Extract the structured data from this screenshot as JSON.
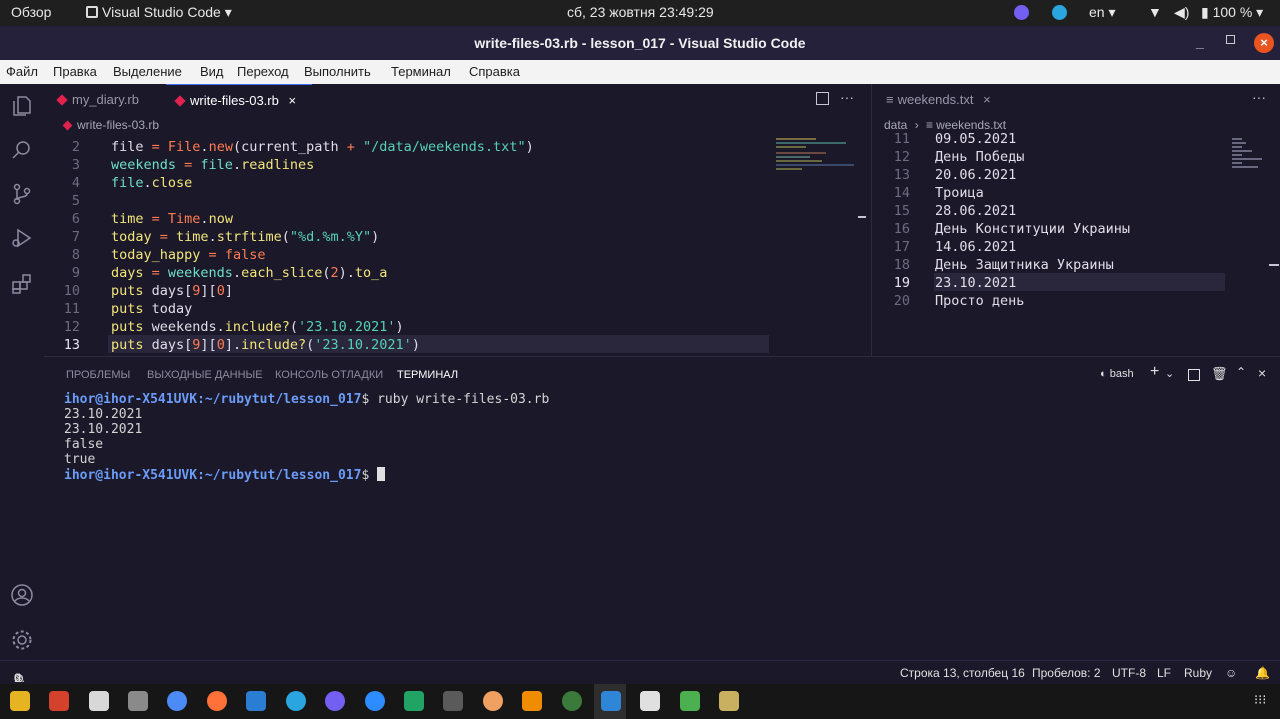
{
  "topbar": {
    "overview": "Обзор",
    "app": "Visual Studio Code",
    "clock": "сб, 23 жовтня  23:49:29",
    "lang": "en",
    "battery": "100 %"
  },
  "window": {
    "title": "write-files-03.rb - lesson_017 - Visual Studio Code"
  },
  "menu": [
    "Файл",
    "Правка",
    "Выделение",
    "Вид",
    "Переход",
    "Выполнить",
    "Терминал",
    "Справка"
  ],
  "left_editor": {
    "tabs": [
      {
        "label": "my_diary.rb"
      },
      {
        "label": "write-files-03.rb"
      }
    ],
    "breadcrumb": "write-files-03.rb",
    "line_numbers": [
      "2",
      "3",
      "4",
      "5",
      "6",
      "7",
      "8",
      "9",
      "10",
      "11",
      "12",
      "13"
    ]
  },
  "right_editor": {
    "tab": "weekends.txt",
    "breadcrumb_folder": "data",
    "breadcrumb_file": "weekends.txt",
    "lines": [
      {
        "num": "11",
        "text": "09.05.2021"
      },
      {
        "num": "12",
        "text": "День Победы"
      },
      {
        "num": "13",
        "text": "20.06.2021"
      },
      {
        "num": "14",
        "text": "Троица"
      },
      {
        "num": "15",
        "text": "28.06.2021"
      },
      {
        "num": "16",
        "text": "День Конституции Украины"
      },
      {
        "num": "17",
        "text": "14.06.2021"
      },
      {
        "num": "18",
        "text": "День Защитника Украины"
      },
      {
        "num": "19",
        "text": "23.10.2021"
      },
      {
        "num": "20",
        "text": "Просто день"
      }
    ]
  },
  "panel": {
    "tabs": [
      "ПРОБЛЕМЫ",
      "ВЫХОДНЫЕ ДАННЫЕ",
      "КОНСОЛЬ ОТЛАДКИ",
      "ТЕРМИНАЛ"
    ],
    "shell": "bash",
    "prompt_user": "ihor@ihor-X541UVK",
    "prompt_path": ":~/rubytut/lesson_017",
    "command": "$ ruby write-files-03.rb",
    "output": [
      "23.10.2021",
      "23.10.2021",
      "false",
      "true"
    ],
    "prompt_end": "$ "
  },
  "status": {
    "errors": "0",
    "warnings": "0",
    "position": "Строка 13, столбец 16",
    "spaces": "Пробелов: 2",
    "encoding": "UTF-8",
    "eol": "LF",
    "language": "Ruby"
  },
  "colors": {
    "background": "#1b1829",
    "accent": "#3a6df0",
    "title_bar": "#26213a",
    "close_button": "#e95420"
  }
}
